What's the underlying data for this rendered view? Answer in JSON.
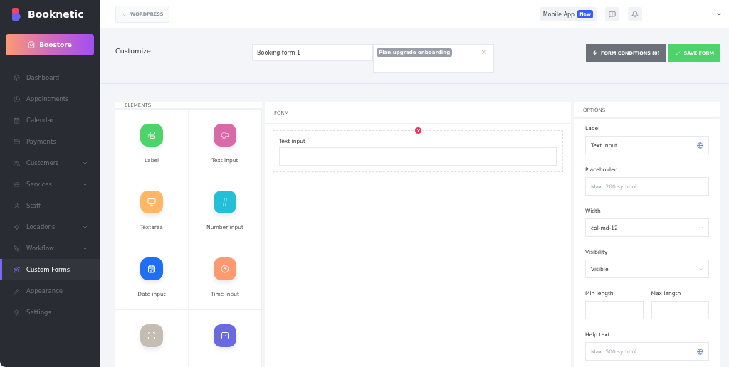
{
  "brand": {
    "name": "Booknetic"
  },
  "boostore": {
    "label": "Boostore"
  },
  "sidebar": {
    "items": [
      {
        "label": "Dashboard",
        "selected": false,
        "expandable": false
      },
      {
        "label": "Appointments",
        "selected": false,
        "expandable": false
      },
      {
        "label": "Calendar",
        "selected": false,
        "expandable": false
      },
      {
        "label": "Payments",
        "selected": false,
        "expandable": false
      },
      {
        "label": "Customers",
        "selected": false,
        "expandable": true
      },
      {
        "label": "Services",
        "selected": false,
        "expandable": true
      },
      {
        "label": "Staff",
        "selected": false,
        "expandable": false
      },
      {
        "label": "Locations",
        "selected": false,
        "expandable": true
      },
      {
        "label": "Workflow",
        "selected": false,
        "expandable": true
      },
      {
        "label": "Custom Forms",
        "selected": true,
        "expandable": false
      },
      {
        "label": "Appearance",
        "selected": false,
        "expandable": false
      },
      {
        "label": "Settings",
        "selected": false,
        "expandable": false
      }
    ]
  },
  "topbar": {
    "back": "WORDPRESS",
    "mobile_app": "Mobile App",
    "badge": "New"
  },
  "header": {
    "title": "Customize",
    "form_name": "Booking form 1",
    "tag": "Plan upgrade onboarding",
    "tag_remove": "×",
    "conditions_button": "FORM CONDITIONS (0)",
    "save_button": "SAVE FORM"
  },
  "elements": {
    "title": "ELEMENTS",
    "items": [
      {
        "label": "Label",
        "color": "#4cd36a"
      },
      {
        "label": "Text input",
        "color": "#d96aa8"
      },
      {
        "label": "Textarea",
        "color": "#ffb766"
      },
      {
        "label": "Number input",
        "color": "#22bfd6"
      },
      {
        "label": "Date input",
        "color": "#1e6ff5"
      },
      {
        "label": "Time input",
        "color": "#ff9a70"
      },
      {
        "color": "#c4bdb4"
      },
      {
        "color": "#6a6adf"
      }
    ]
  },
  "form": {
    "title": "FORM",
    "fields": [
      {
        "label": "Text input"
      }
    ]
  },
  "options": {
    "title": "OPTIONS",
    "rows": [
      {
        "kind": "text",
        "label": "Label",
        "value": "Text input",
        "translatable": true
      },
      {
        "kind": "text",
        "label": "Placeholder",
        "placeholder": "Max: 200 symbol",
        "translatable": false
      },
      {
        "kind": "select",
        "label": "Width",
        "value": "col-md-12"
      },
      {
        "kind": "select",
        "label": "Visibility",
        "value": "Visible"
      },
      {
        "kind": "pair",
        "labels": [
          "Min length",
          "Max length"
        ]
      },
      {
        "kind": "text",
        "label": "Help text",
        "placeholder": "Max: 500 symbol",
        "translatable": true
      }
    ]
  }
}
